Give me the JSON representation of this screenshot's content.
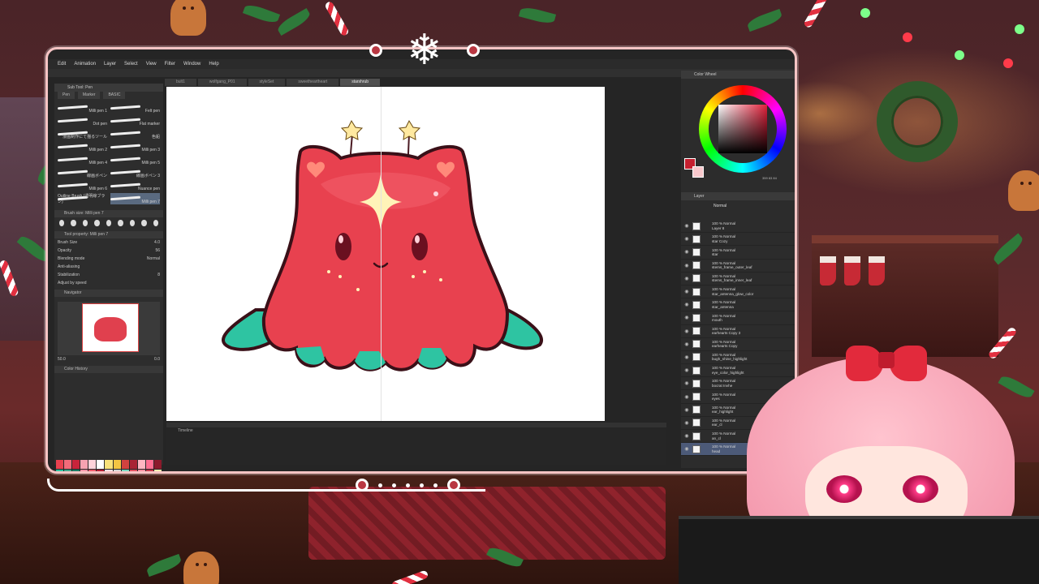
{
  "app": {
    "menu": [
      "Edit",
      "Animation",
      "Layer",
      "Select",
      "View",
      "Filter",
      "Window",
      "Help"
    ],
    "doc_tabs": [
      "bult1",
      "wolfgang_P01",
      "styleSet",
      "sweetheartheart",
      "starshrub"
    ],
    "active_doc_tab": 4
  },
  "subtool": {
    "header": "Sub Tool: Pen",
    "tabs": [
      "Pen",
      "Marker",
      "BASIC"
    ],
    "brushes": [
      {
        "label": "Milli pen 1"
      },
      {
        "label": "Felt pen"
      },
      {
        "label": "Dot pen"
      },
      {
        "label": "Flat marker"
      },
      {
        "label": "漫画制作にて描るツール"
      },
      {
        "label": "色鉛"
      },
      {
        "label": "Milli pen 2"
      },
      {
        "label": "Milli pen 3"
      },
      {
        "label": "Milli pen 4"
      },
      {
        "label": "Milli pen 5"
      },
      {
        "label": "線画ボペン"
      },
      {
        "label": "線画ボペン 3"
      },
      {
        "label": "Milli pen 6"
      },
      {
        "label": "Nuance pen"
      },
      {
        "label": "Outline Brush (透明線ブラシ)"
      },
      {
        "label": "Milli pen 7"
      }
    ],
    "selected_brush": 15
  },
  "brush_size": {
    "header": "Brush size: Milli pen 7",
    "values": [
      "0.7",
      "1",
      "1.5",
      "2",
      "2.5",
      "3",
      "4",
      "5",
      "6"
    ]
  },
  "tool_property": {
    "header": "Tool property: Milli pen 7",
    "rows": [
      {
        "label": "Brush Size",
        "value": "4.0"
      },
      {
        "label": "Opacity",
        "value": "56"
      },
      {
        "label": "Blending mode",
        "value": "Normal"
      },
      {
        "label": "Anti-aliasing",
        "value": ""
      },
      {
        "label": "Stabilization",
        "value": "8"
      },
      {
        "label": "Adjust by speed",
        "value": ""
      }
    ]
  },
  "navigator": {
    "header": "Navigator",
    "zoom": "50.0",
    "angle": "0.0"
  },
  "color_history": {
    "header": "Color History"
  },
  "palette_colors": [
    "#e8414f",
    "#f26b7a",
    "#c9243b",
    "#f7a3b1",
    "#ffd3da",
    "#ffffff",
    "#f9e27a",
    "#f4c542",
    "#d2423f",
    "#a82434",
    "#ffb6c1",
    "#ff6f91",
    "#8b1a2b",
    "#2ec4a2",
    "#3fa88d",
    "#1b7a66",
    "#ff94a8",
    "#f05a6a",
    "#b71f34",
    "#ffe3e8",
    "#d9d9d9",
    "#7ad9c2",
    "#e05260",
    "#ff8fa0",
    "#c63b4b",
    "#fff0b3",
    "#ff5468",
    "#e6a0aa",
    "#5ec2a8",
    "#14695a",
    "#ff3355",
    "#ffc0cb",
    "#ea7a86",
    "#ba2a3a",
    "#f3f3f3",
    "#ffbdc6",
    "#d8354b",
    "#9e1b30",
    "#fae6a0",
    "#6cc9b3",
    "#2d9c84",
    "#ffd6df",
    "#ff7a8c",
    "#f04058",
    "#c22138",
    "#ffe9a8",
    "#a6ead9",
    "#ff2e4c",
    "#ffa0b0",
    "#e3344a",
    "#8a1628",
    "#ffffff"
  ],
  "timeline": {
    "header": "Timeline"
  },
  "color_wheel": {
    "header": "Color Wheel",
    "readout": "359 83 84",
    "main_color": "#c41f2f",
    "sub_color": "#f8c8cc"
  },
  "layers": {
    "header": "Layer",
    "blend_mode": "Normal",
    "rows": [
      {
        "opacity": "100 % Normal",
        "name": "Layer 8"
      },
      {
        "opacity": "100 % Normal",
        "name": "star Cozy"
      },
      {
        "opacity": "100 % Normal",
        "name": "star"
      },
      {
        "opacity": "100 % Normal",
        "name": "stems_frame_outer_leaf"
      },
      {
        "opacity": "100 % Normal",
        "name": "stems_frame_inner_leaf"
      },
      {
        "opacity": "100 % Normal",
        "name": "star_antenna_glow_color"
      },
      {
        "opacity": "100 % Normal",
        "name": "star_antenna"
      },
      {
        "opacity": "100 % Normal",
        "name": "mouth"
      },
      {
        "opacity": "100 % Normal",
        "name": "earhearts Copy 3"
      },
      {
        "opacity": "100 % Normal",
        "name": "earhearts Copy"
      },
      {
        "opacity": "100 % Normal",
        "name": "bugh_shine_highlight"
      },
      {
        "opacity": "100 % Normal",
        "name": "eye_color_highlight"
      },
      {
        "opacity": "100 % Normal",
        "name": "bocrat Invhe"
      },
      {
        "opacity": "100 % Normal",
        "name": "eyes"
      },
      {
        "opacity": "100 % Normal",
        "name": "ear_highlight"
      },
      {
        "opacity": "100 % Normal",
        "name": "ear_cl"
      },
      {
        "opacity": "100 % Normal",
        "name": "an_cl"
      },
      {
        "opacity": "100 % Normal",
        "name": "head"
      }
    ],
    "selected_index": 17
  },
  "colors": {
    "frame_border": "#f6c4c4",
    "accent_red": "#c41f2f",
    "creature_body": "#e8414f",
    "creature_tentacle": "#2ec4a2"
  }
}
